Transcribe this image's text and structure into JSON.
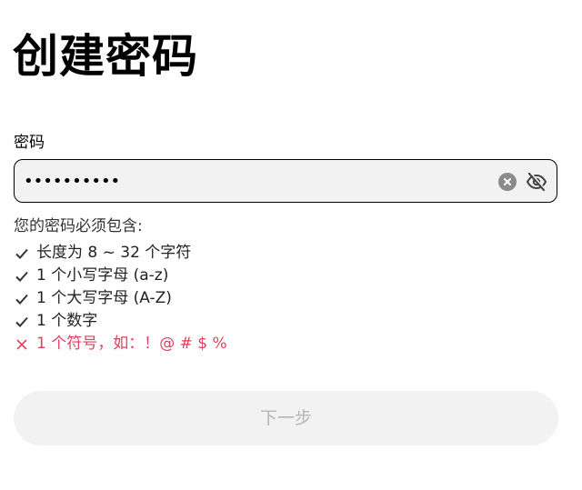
{
  "page": {
    "title": "创建密码"
  },
  "password_field": {
    "label": "密码",
    "value": "••••••••••",
    "clear_icon": "clear-icon",
    "visibility_icon": "eye-off-icon"
  },
  "requirements": {
    "title": "您的密码必须包含:",
    "items": [
      {
        "text": "长度为 8 ~ 32 个字符",
        "status": "pass",
        "icon": "check-icon"
      },
      {
        "text": "1 个小写字母 (a-z)",
        "status": "pass",
        "icon": "check-icon"
      },
      {
        "text": "1 个大写字母 (A-Z)",
        "status": "pass",
        "icon": "check-icon"
      },
      {
        "text": "1 个数字",
        "status": "pass",
        "icon": "check-icon"
      },
      {
        "text": "1 个符号，如：！@ # $ %",
        "status": "fail",
        "icon": "cross-icon"
      }
    ]
  },
  "next_button": {
    "label": "下一步",
    "enabled": false
  },
  "colors": {
    "error": "#e0405e",
    "input_bg": "#f2f2f2",
    "disabled_text": "#b5b5b5"
  }
}
